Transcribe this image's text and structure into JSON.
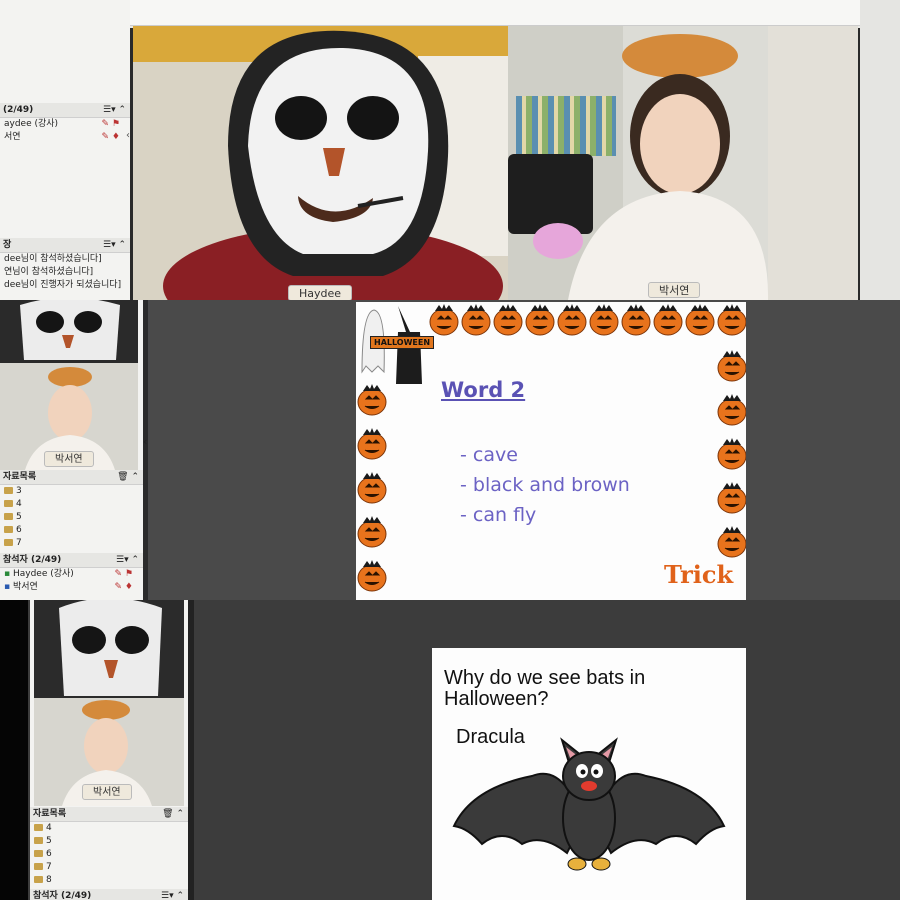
{
  "strip1": {
    "panel": {
      "participants_header": "(2/49)",
      "participants": [
        "aydee (강사)",
        "서연"
      ],
      "chat_header": "장",
      "chat_lines": [
        "dee님이 참석하셨습니다]",
        "연님이 참석하셨습니다]",
        "dee님이 진행자가 되셨습니다]"
      ]
    },
    "video_left_name": "Haydee",
    "video_right_name": "박서연"
  },
  "strip2": {
    "video_name": "박서연",
    "materials_header": "자료목록",
    "materials": [
      "3",
      "4",
      "5",
      "6",
      "7"
    ],
    "participants_header": "참석자 (2/49)",
    "participants": [
      "Haydee (강사)",
      "박서연"
    ],
    "slide": {
      "badge": "HALLOWEEN",
      "title": "Word 2",
      "bullets": [
        "- cave",
        "- black and brown",
        "- can fly"
      ],
      "corner_text": "Trick"
    }
  },
  "strip3": {
    "video_name": "박서연",
    "materials_header": "자료목록",
    "materials": [
      "4",
      "5",
      "6",
      "7",
      "8"
    ],
    "participants_header": "참석자 (2/49)",
    "slide": {
      "question": "Why do we see bats in Halloween?",
      "answer": "Dracula"
    }
  },
  "colors": {
    "slide_text": "#6b62c4",
    "pumpkin": "#e8731c",
    "bat_body": "#3a3a3a"
  }
}
